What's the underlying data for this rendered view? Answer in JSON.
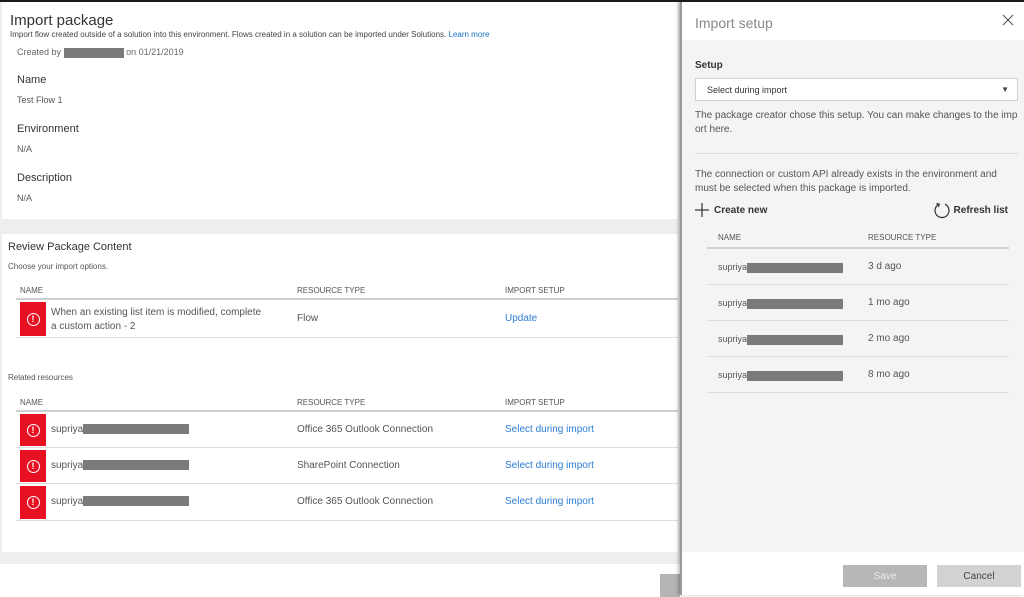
{
  "page": {
    "title": "Import package",
    "subtitle": "Import flow created outside of a solution into this environment. Flows created in a solution can be imported under Solutions.",
    "learn_more": "Learn more",
    "created_prefix": "Created by",
    "created_suffix": "on 01/21/2019"
  },
  "details": {
    "name_label": "Name",
    "name_value": "Test Flow 1",
    "environment_label": "Environment",
    "environment_value": "N/A",
    "description_label": "Description",
    "description_value": "N/A"
  },
  "review": {
    "title": "Review Package Content",
    "subtitle": "Choose your import options.",
    "columns": [
      "NAME",
      "RESOURCE TYPE",
      "IMPORT SETUP"
    ],
    "rows": [
      {
        "name_line1": "When an existing list item is modified, complete",
        "name_line2": "a custom action - 2",
        "type": "Flow",
        "setup": "Update",
        "status": "error"
      }
    ]
  },
  "related": {
    "title": "Related resources",
    "columns": [
      "NAME",
      "RESOURCE TYPE",
      "IMPORT SETUP"
    ],
    "rows": [
      {
        "name": "supriya",
        "type": "Office 365 Outlook Connection",
        "setup": "Select during import",
        "status": "error"
      },
      {
        "name": "supriya",
        "type": "SharePoint Connection",
        "setup": "Select during import",
        "status": "error"
      },
      {
        "name": "supriya",
        "type": "Office 365 Outlook Connection",
        "setup": "Select during import",
        "status": "error"
      }
    ]
  },
  "panel": {
    "title": "Import setup",
    "close_icon": "close-icon",
    "setup_label": "Setup",
    "setup_selected": "Select during import",
    "setup_help": "The package creator chose this setup. You can make changes to the import here.",
    "connection_help": "The connection or custom API already exists in the environment and must be selected when this package is imported.",
    "create_new": "Create new",
    "refresh_list": "Refresh list",
    "columns": [
      "NAME",
      "RESOURCE TYPE"
    ],
    "rows": [
      {
        "name": "supriya",
        "type": "3 d ago"
      },
      {
        "name": "supriya",
        "type": "1 mo ago"
      },
      {
        "name": "supriya",
        "type": "2 mo ago"
      },
      {
        "name": "supriya",
        "type": "8 mo ago"
      }
    ],
    "save": "Save",
    "cancel": "Cancel"
  },
  "colors": {
    "error": "#e81123",
    "link": "#2b7cd3",
    "panel_bg": "#f4f4f4"
  }
}
